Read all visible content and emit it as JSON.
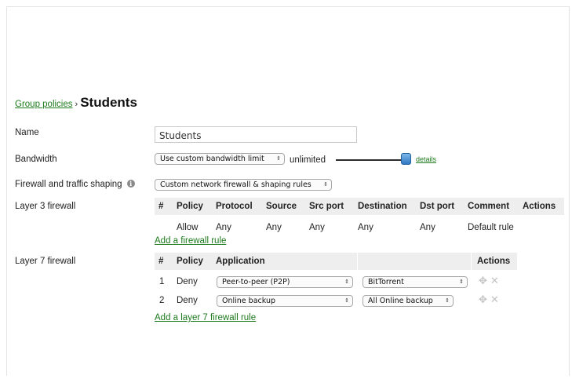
{
  "breadcrumb": {
    "parent": "Group policies",
    "separator": "›",
    "current": "Students"
  },
  "labels": {
    "name": "Name",
    "bandwidth": "Bandwidth",
    "firewall_shaping": "Firewall and traffic shaping",
    "layer3": "Layer 3 firewall",
    "layer7": "Layer 7 firewall"
  },
  "name_field": {
    "value": "Students"
  },
  "bandwidth": {
    "mode": "Use custom bandwidth limit",
    "value_text": "unlimited",
    "details_link": "details"
  },
  "firewall_shaping": {
    "mode": "Custom network firewall & shaping rules"
  },
  "icons": {
    "info": "i",
    "select_arrow": "⇕",
    "move": "✥",
    "delete": "✕"
  },
  "layer3": {
    "headers": [
      "#",
      "Policy",
      "Protocol",
      "Source",
      "Src port",
      "Destination",
      "Dst port",
      "Comment",
      "Actions"
    ],
    "rows": [
      {
        "num": "",
        "policy": "Allow",
        "protocol": "Any",
        "source": "Any",
        "src_port": "Any",
        "destination": "Any",
        "dst_port": "Any",
        "comment": "Default rule"
      }
    ],
    "add_link": "Add a firewall rule"
  },
  "layer7": {
    "headers": [
      "#",
      "Policy",
      "Application",
      "",
      "Actions"
    ],
    "rows": [
      {
        "num": "1",
        "policy": "Deny",
        "category": "Peer-to-peer (P2P)",
        "app": "BitTorrent"
      },
      {
        "num": "2",
        "policy": "Deny",
        "category": "Online backup",
        "app": "All Online backup"
      }
    ],
    "add_link": "Add a layer 7 firewall rule"
  },
  "colors": {
    "link": "#1d7a1d",
    "header_bg": "#eeeeee",
    "slider_knob": "#2f78c2"
  }
}
